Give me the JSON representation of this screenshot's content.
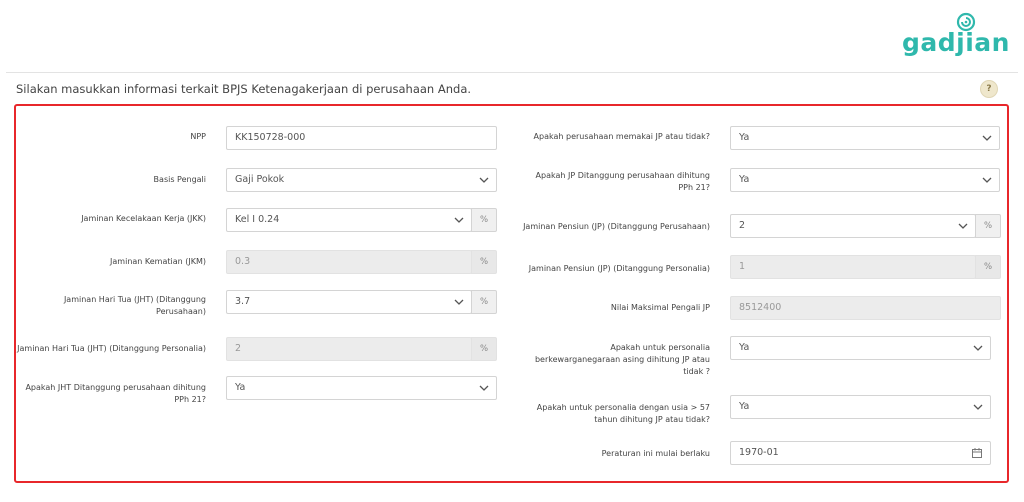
{
  "brand": {
    "logo_text": "gadjian"
  },
  "header": {
    "intro_text": "Silakan masukkan informasi terkait BPJS Ketenagakerjaan di perusahaan Anda.",
    "help_label": "?"
  },
  "left": {
    "npp": {
      "label": "NPP",
      "value": "KK150728-000"
    },
    "basis_pengali": {
      "label": "Basis Pengali",
      "value": "Gaji Pokok"
    },
    "jkk": {
      "label": "Jaminan Kecelakaan Kerja (JKK)",
      "value": "Kel I 0.24",
      "unit": "%"
    },
    "jkm": {
      "label": "Jaminan Kematian (JKM)",
      "value": "0.3",
      "unit": "%"
    },
    "jht_perusahaan": {
      "label_line1": "Jaminan Hari Tua (JHT) (Ditanggung",
      "label_line2": "Perusahaan)",
      "value": "3.7",
      "unit": "%"
    },
    "jht_personalia": {
      "label": "Jaminan Hari Tua (JHT) (Ditanggung Personalia)",
      "value": "2",
      "unit": "%"
    },
    "jht_pph21": {
      "label_line1": "Apakah JHT Ditanggung perusahaan dihitung",
      "label_line2": "PPh 21?",
      "value": "Ya"
    }
  },
  "right": {
    "jp_dipakai": {
      "label": "Apakah perusahaan memakai JP atau tidak?",
      "value": "Ya"
    },
    "jp_pph21": {
      "label_line1": "Apakah JP Ditanggung perusahaan dihitung",
      "label_line2": "PPh 21?",
      "value": "Ya"
    },
    "jp_perusahaan": {
      "label": "Jaminan Pensiun (JP) (Ditanggung Perusahaan)",
      "value": "2",
      "unit": "%"
    },
    "jp_personalia": {
      "label": "Jaminan Pensiun (JP) (Ditanggung Personalia)",
      "value": "1",
      "unit": "%"
    },
    "nilai_maks": {
      "label": "Nilai Maksimal Pengali JP",
      "value": "8512400"
    },
    "jp_wna": {
      "label_line1": "Apakah untuk personalia",
      "label_line2": "berkewarganegaraan asing dihitung JP atau",
      "label_line3": "tidak ?",
      "value": "Ya"
    },
    "jp_usia57": {
      "label_line1": "Apakah untuk personalia dengan usia > 57",
      "label_line2": "tahun dihitung JP atau tidak?",
      "value": "Ya"
    },
    "mulai_berlaku": {
      "label": "Peraturan ini mulai berlaku",
      "value": "1970-01"
    }
  },
  "colors": {
    "brand": "#2fb8ac",
    "highlight_border": "#e8272b",
    "readonly_bg": "#ececec"
  },
  "icons": {
    "dropdown": "chevron-down-icon",
    "date": "calendar-icon",
    "help": "question-icon"
  }
}
